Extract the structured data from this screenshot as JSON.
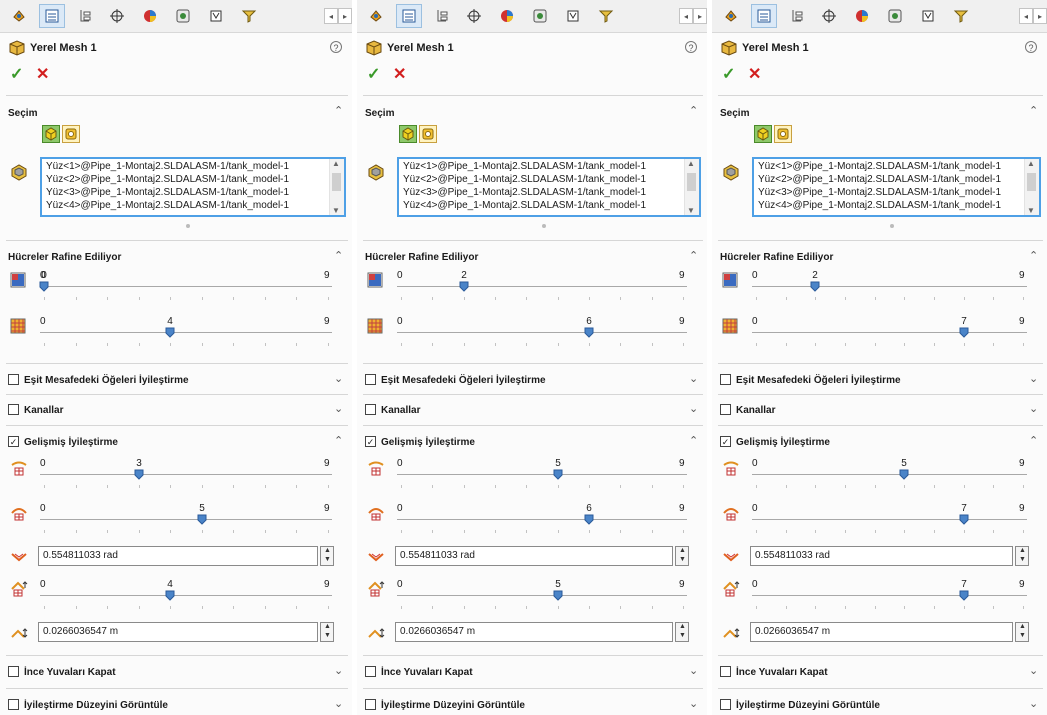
{
  "panels": [
    {
      "title": "Yerel Mesh 1",
      "selection": {
        "header": "Seçim",
        "items": [
          "Yüz<1>@Pipe_1-Montaj2.SLDALASM-1/tank_model-1",
          "Yüz<2>@Pipe_1-Montaj2.SLDALASM-1/tank_model-1",
          "Yüz<3>@Pipe_1-Montaj2.SLDALASM-1/tank_model-1",
          "Yüz<4>@Pipe_1-Montaj2.SLDALASM-1/tank_model-1"
        ]
      },
      "refining": {
        "header": "Hücreler Rafine Ediliyor",
        "sliders": [
          {
            "name": "basic-refinement",
            "min": "0",
            "max": "9",
            "value": 0,
            "value_label": "0"
          },
          {
            "name": "refinement-level",
            "min": "0",
            "max": "9",
            "value": 4,
            "value_label": "4"
          }
        ]
      },
      "equidistant_label": "Eşit Mesafedeki Öğeleri İyileştirme",
      "channels_label": "Kanallar",
      "advanced": {
        "label": "Gelişmiş İyileştirme",
        "sliders": [
          {
            "name": "small-solid-features",
            "min": "0",
            "max": "9",
            "value": 3,
            "value_label": "3"
          },
          {
            "name": "curvature",
            "min": "0",
            "max": "9",
            "value": 5,
            "value_label": "5"
          }
        ],
        "curvature_criterion": "0.554811033 rad",
        "tolerance_slider": {
          "name": "tolerance-refinement",
          "min": "0",
          "max": "9",
          "value": 4,
          "value_label": "4"
        },
        "tolerance_criterion": "0.0266036547 m"
      },
      "close_gaps_label": "İnce Yuvaları Kapat",
      "display_level_label": "İyileştirme Düzeyini Görüntüle"
    },
    {
      "title": "Yerel Mesh 1",
      "selection": {
        "header": "Seçim",
        "items": [
          "Yüz<1>@Pipe_1-Montaj2.SLDALASM-1/tank_model-1",
          "Yüz<2>@Pipe_1-Montaj2.SLDALASM-1/tank_model-1",
          "Yüz<3>@Pipe_1-Montaj2.SLDALASM-1/tank_model-1",
          "Yüz<4>@Pipe_1-Montaj2.SLDALASM-1/tank_model-1"
        ]
      },
      "refining": {
        "header": "Hücreler Rafine Ediliyor",
        "sliders": [
          {
            "name": "basic-refinement",
            "min": "0",
            "max": "9",
            "value": 2,
            "value_label": "2"
          },
          {
            "name": "refinement-level",
            "min": "0",
            "max": "9",
            "value": 6,
            "value_label": "6"
          }
        ]
      },
      "equidistant_label": "Eşit Mesafedeki Öğeleri İyileştirme",
      "channels_label": "Kanallar",
      "advanced": {
        "label": "Gelişmiş İyileştirme",
        "sliders": [
          {
            "name": "small-solid-features",
            "min": "0",
            "max": "9",
            "value": 5,
            "value_label": "5"
          },
          {
            "name": "curvature",
            "min": "0",
            "max": "9",
            "value": 6,
            "value_label": "6"
          }
        ],
        "curvature_criterion": "0.554811033 rad",
        "tolerance_slider": {
          "name": "tolerance-refinement",
          "min": "0",
          "max": "9",
          "value": 5,
          "value_label": "5"
        },
        "tolerance_criterion": "0.0266036547 m"
      },
      "close_gaps_label": "İnce Yuvaları Kapat",
      "display_level_label": "İyileştirme Düzeyini Görüntüle"
    },
    {
      "title": "Yerel Mesh 1",
      "selection": {
        "header": "Seçim",
        "items": [
          "Yüz<1>@Pipe_1-Montaj2.SLDALASM-1/tank_model-1",
          "Yüz<2>@Pipe_1-Montaj2.SLDALASM-1/tank_model-1",
          "Yüz<3>@Pipe_1-Montaj2.SLDALASM-1/tank_model-1",
          "Yüz<4>@Pipe_1-Montaj2.SLDALASM-1/tank_model-1"
        ]
      },
      "refining": {
        "header": "Hücreler Rafine Ediliyor",
        "sliders": [
          {
            "name": "basic-refinement",
            "min": "0",
            "max": "9",
            "value": 2,
            "value_label": "2"
          },
          {
            "name": "refinement-level",
            "min": "0",
            "max": "9",
            "value": 7,
            "value_label": "7"
          }
        ]
      },
      "equidistant_label": "Eşit Mesafedeki Öğeleri İyileştirme",
      "channels_label": "Kanallar",
      "advanced": {
        "label": "Gelişmiş İyileştirme",
        "sliders": [
          {
            "name": "small-solid-features",
            "min": "0",
            "max": "9",
            "value": 5,
            "value_label": "5"
          },
          {
            "name": "curvature",
            "min": "0",
            "max": "9",
            "value": 7,
            "value_label": "7"
          }
        ],
        "curvature_criterion": "0.554811033 rad",
        "tolerance_slider": {
          "name": "tolerance-refinement",
          "min": "0",
          "max": "9",
          "value": 7,
          "value_label": "7"
        },
        "tolerance_criterion": "0.0266036547 m"
      },
      "close_gaps_label": "İnce Yuvaları Kapat",
      "display_level_label": "İyileştirme Düzeyini Görüntüle"
    }
  ],
  "colors": {
    "accent_blue": "#4ea0e6",
    "slider_thumb": "#4a84c8",
    "ok_green": "#3a9a2a",
    "cancel_red": "#d21e1e"
  },
  "icons": {
    "toolbar": [
      "property-manager-icon",
      "feature-tree-icon",
      "configuration-icon",
      "dimxpert-icon",
      "appearance-icon",
      "display-manager-icon",
      "cam-icon",
      "filter-icon"
    ],
    "title": "mesh-settings-icon",
    "selection_types": [
      "face-selection-icon",
      "component-selection-icon"
    ],
    "selection_list": "selected-faces-icon",
    "sliders": [
      "basic-refinement-icon",
      "refinement-level-icon",
      "small-solid-features-icon",
      "curvature-refinement-icon",
      "curvature-criterion-icon",
      "tolerance-refinement-icon",
      "tolerance-criterion-icon"
    ]
  }
}
